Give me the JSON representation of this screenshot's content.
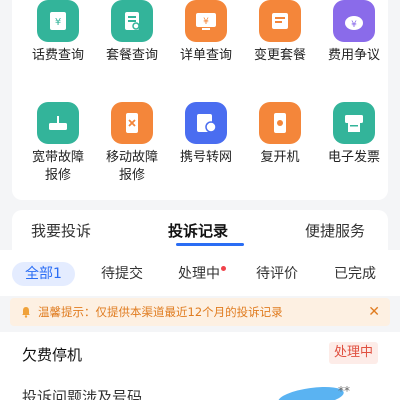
{
  "services": [
    {
      "label": "话费查询",
      "icon": "bill-query-icon",
      "color": "#33b49a"
    },
    {
      "label": "套餐查询",
      "icon": "package-query-icon",
      "color": "#33b49a"
    },
    {
      "label": "详单查询",
      "icon": "detail-bill-icon",
      "color": "#f4863a"
    },
    {
      "label": "变更套餐",
      "icon": "change-package-icon",
      "color": "#f4863a"
    },
    {
      "label": "费用争议",
      "icon": "fee-dispute-icon",
      "color": "#8a6bea"
    },
    {
      "label": "宽带故障\n报修",
      "icon": "broadband-fault-icon",
      "color": "#33b49a"
    },
    {
      "label": "移动故障\n报修",
      "icon": "mobile-fault-icon",
      "color": "#f4863a"
    },
    {
      "label": "携号转网",
      "icon": "number-transfer-icon",
      "color": "#4a6df0"
    },
    {
      "label": "复开机",
      "icon": "restart-service-icon",
      "color": "#f4863a"
    },
    {
      "label": "电子发票",
      "icon": "e-invoice-icon",
      "color": "#33b49a"
    }
  ],
  "tabs": [
    {
      "label": "我要投诉"
    },
    {
      "label": "投诉记录"
    },
    {
      "label": "便捷服务"
    }
  ],
  "filters": [
    {
      "label": "全部1"
    },
    {
      "label": "待提交"
    },
    {
      "label": "处理中"
    },
    {
      "label": "待评价"
    },
    {
      "label": "已完成"
    }
  ],
  "notice": {
    "text": "温馨提示：仅提供本渠道最近12个月的投诉记录",
    "close": "✕"
  },
  "record": {
    "title": "欠费停机",
    "status": "处理中",
    "field_label": "投诉问题涉及号码",
    "masked_suffix": "**"
  }
}
